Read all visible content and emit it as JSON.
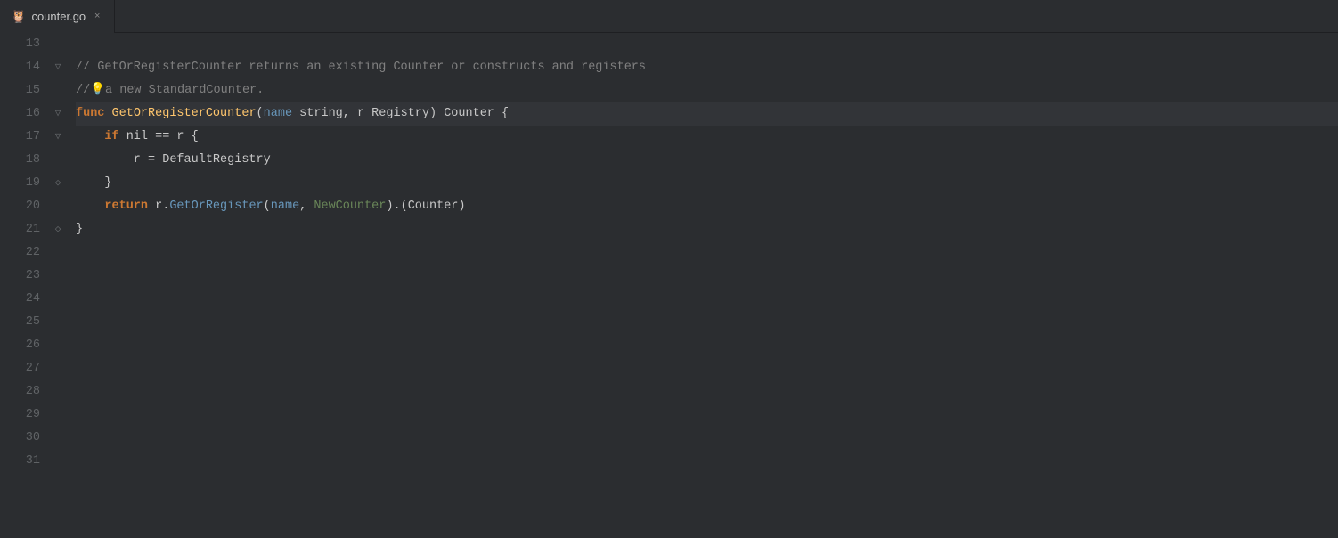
{
  "tab": {
    "icon": "🦉",
    "label": "counter.go",
    "close_label": "×",
    "active": true
  },
  "editor": {
    "bg_color": "#2b2d30",
    "highlight_line": 16,
    "lines": [
      {
        "num": 13,
        "content": [],
        "fold": null
      },
      {
        "num": 14,
        "fold": "fold-open",
        "content": [
          {
            "text": "// GetOrRegisterCounter returns an existing Counter or constructs and registers",
            "cls": "comment"
          }
        ]
      },
      {
        "num": 15,
        "fold": null,
        "content": [
          {
            "text": "//",
            "cls": "comment"
          },
          {
            "text": "💡",
            "cls": "comment-special"
          },
          {
            "text": "a new StandardCounter.",
            "cls": "comment"
          }
        ]
      },
      {
        "num": 16,
        "fold": "fold-open",
        "highlighted": true,
        "content": [
          {
            "text": "func ",
            "cls": "kw"
          },
          {
            "text": "GetOrRegisterCounter",
            "cls": "fn"
          },
          {
            "text": "(",
            "cls": "plain"
          },
          {
            "text": "name",
            "cls": "param"
          },
          {
            "text": " string, r Registry) Counter {",
            "cls": "plain"
          }
        ]
      },
      {
        "num": 17,
        "fold": "fold-open",
        "content": [
          {
            "text": "    ",
            "cls": "plain"
          },
          {
            "text": "if",
            "cls": "kw"
          },
          {
            "text": " nil == r {",
            "cls": "plain"
          }
        ]
      },
      {
        "num": 18,
        "fold": null,
        "content": [
          {
            "text": "        r = DefaultRegistry",
            "cls": "plain"
          }
        ]
      },
      {
        "num": 19,
        "fold": "fold-close",
        "content": [
          {
            "text": "    }",
            "cls": "plain"
          }
        ]
      },
      {
        "num": 20,
        "fold": null,
        "content": [
          {
            "text": "    ",
            "cls": "plain"
          },
          {
            "text": "return",
            "cls": "kw"
          },
          {
            "text": " r.",
            "cls": "plain"
          },
          {
            "text": "GetOrRegister",
            "cls": "method"
          },
          {
            "text": "(",
            "cls": "plain"
          },
          {
            "text": "name",
            "cls": "arg-name"
          },
          {
            "text": ", ",
            "cls": "plain"
          },
          {
            "text": "NewCounter",
            "cls": "arg-method"
          },
          {
            "text": ").(Counter)",
            "cls": "plain"
          }
        ]
      },
      {
        "num": 21,
        "fold": "fold-close",
        "content": [
          {
            "text": "}",
            "cls": "plain"
          }
        ]
      },
      {
        "num": 22,
        "content": [],
        "fold": null
      },
      {
        "num": 23,
        "content": [],
        "fold": null
      },
      {
        "num": 24,
        "content": [],
        "fold": null
      },
      {
        "num": 25,
        "content": [],
        "fold": null
      },
      {
        "num": 26,
        "content": [],
        "fold": null
      },
      {
        "num": 27,
        "content": [],
        "fold": null
      },
      {
        "num": 28,
        "content": [],
        "fold": null
      },
      {
        "num": 29,
        "content": [],
        "fold": null
      },
      {
        "num": 30,
        "content": [],
        "fold": null
      },
      {
        "num": 31,
        "content": [],
        "fold": null
      }
    ]
  }
}
